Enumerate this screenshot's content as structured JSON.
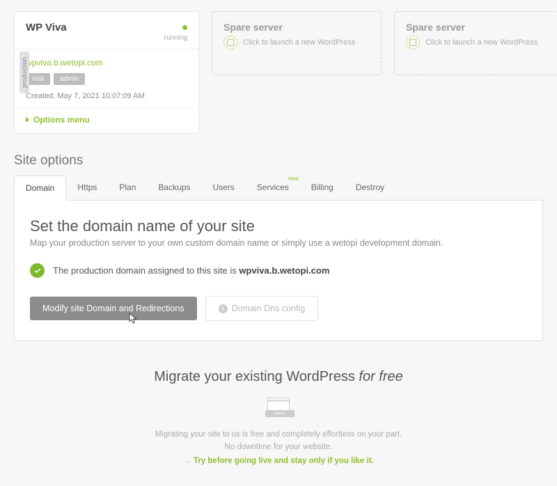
{
  "siteCard": {
    "title": "WP Viva",
    "status": "running",
    "domain": "wpviva.b.wetopi.com",
    "visit": "visit",
    "admin": "admin",
    "created": "Created: May 7, 2021 10:07:09 AM",
    "optionsMenu": "Options menu",
    "productionLabel": "production"
  },
  "spare": {
    "title": "Spare server",
    "text": "Click to launch a new WordPress"
  },
  "sectionTitle": "Site options",
  "tabs": {
    "domain": "Domain",
    "https": "Https",
    "plan": "Plan",
    "backups": "Backups",
    "users": "Users",
    "services": "Services",
    "servicesBadge": "new",
    "billing": "Billing",
    "destroy": "Destroy"
  },
  "panel": {
    "heading": "Set the domain name of your site",
    "sub": "Map your production server to your own custom domain name or simply use a wetopi development domain.",
    "checkPrefix": "The production domain assigned to this site is ",
    "checkDomain": "wpviva.b.wetopi.com",
    "modifyBtn": "Modify site Domain and Redirections",
    "dnsBtn": "Domain Dns config"
  },
  "migrate": {
    "headingA": "Migrate your existing WordPress ",
    "headingB": "for free",
    "line1": "Migrating your site to us is free and completely effortless on your part.",
    "line2": "No downtime for your website.",
    "cta": "Try before going live and stay only if you like it."
  }
}
